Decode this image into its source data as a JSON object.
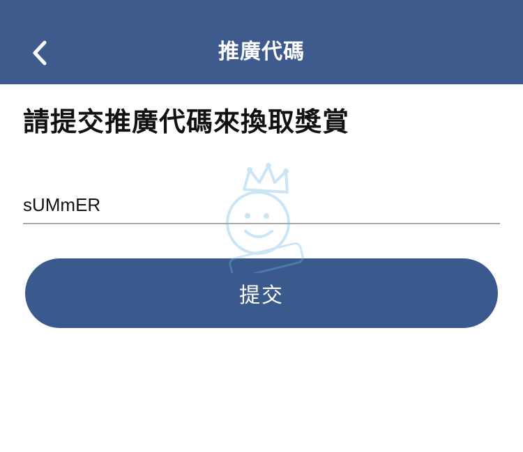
{
  "header": {
    "title": "推廣代碼",
    "back_icon": "chevron-left-icon",
    "background": "#3f5b8d"
  },
  "form": {
    "prompt": "請提交推廣代碼來換取獎賞",
    "code_value": "sUMmER",
    "submit_label": "提交",
    "button_color": "#3a5a8d"
  },
  "watermark": {
    "icon": "chef-baby-logo-icon",
    "color": "#6fb7e6"
  }
}
